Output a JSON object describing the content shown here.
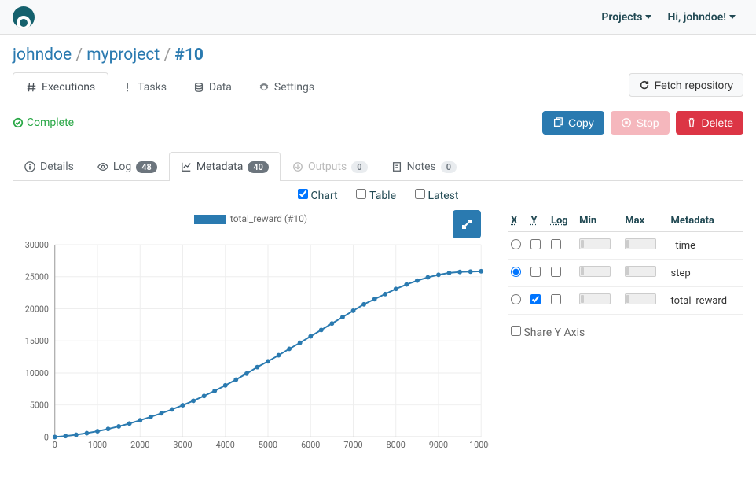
{
  "nav": {
    "projects": "Projects",
    "greeting": "Hi, johndoe!"
  },
  "breadcrumb": {
    "user": "johndoe",
    "project": "myproject",
    "run": "#10"
  },
  "tabs": {
    "executions": "Executions",
    "tasks": "Tasks",
    "data": "Data",
    "settings": "Settings"
  },
  "fetch_repo": "Fetch repository",
  "status": "Complete",
  "actions": {
    "copy": "Copy",
    "stop": "Stop",
    "delete": "Delete"
  },
  "subtabs": {
    "details": "Details",
    "log": "Log",
    "log_badge": "48",
    "metadata": "Metadata",
    "metadata_badge": "40",
    "outputs": "Outputs",
    "outputs_badge": "0",
    "notes": "Notes",
    "notes_badge": "0"
  },
  "view": {
    "chart": "Chart",
    "table": "Table",
    "latest": "Latest"
  },
  "legend": "total_reward (#10)",
  "meta_headers": {
    "x": "X",
    "y": "Y",
    "log": "Log",
    "min": "Min",
    "max": "Max",
    "metadata": "Metadata"
  },
  "meta_rows": [
    {
      "name": "_time",
      "x": false,
      "y": false,
      "log": false
    },
    {
      "name": "step",
      "x": true,
      "y": false,
      "log": false
    },
    {
      "name": "total_reward",
      "x": false,
      "y": true,
      "log": false
    }
  ],
  "share_y": "Share Y Axis",
  "chart_data": {
    "type": "line",
    "title": "",
    "xlabel": "",
    "ylabel": "",
    "xlim": [
      0,
      10000
    ],
    "ylim": [
      0,
      30000
    ],
    "xticks": [
      0,
      1000,
      2000,
      3000,
      4000,
      5000,
      6000,
      7000,
      8000,
      9000,
      10000
    ],
    "yticks": [
      0,
      5000,
      10000,
      15000,
      20000,
      25000,
      30000
    ],
    "series": [
      {
        "name": "total_reward (#10)",
        "x": [
          0,
          250,
          500,
          750,
          1000,
          1250,
          1500,
          1750,
          2000,
          2250,
          2500,
          2750,
          3000,
          3250,
          3500,
          3750,
          4000,
          4250,
          4500,
          4750,
          5000,
          5250,
          5500,
          5750,
          6000,
          6250,
          6500,
          6750,
          7000,
          7250,
          7500,
          7750,
          8000,
          8250,
          8500,
          8750,
          9000,
          9250,
          9500,
          9750,
          10000
        ],
        "y": [
          0,
          150,
          350,
          600,
          900,
          1250,
          1650,
          2100,
          2600,
          3150,
          3700,
          4300,
          4950,
          5650,
          6400,
          7200,
          8050,
          8950,
          9900,
          10900,
          11800,
          12750,
          13750,
          14700,
          15700,
          16700,
          17700,
          18700,
          19700,
          20700,
          21500,
          22300,
          23100,
          23800,
          24400,
          24900,
          25300,
          25600,
          25750,
          25800,
          25850
        ]
      }
    ]
  }
}
